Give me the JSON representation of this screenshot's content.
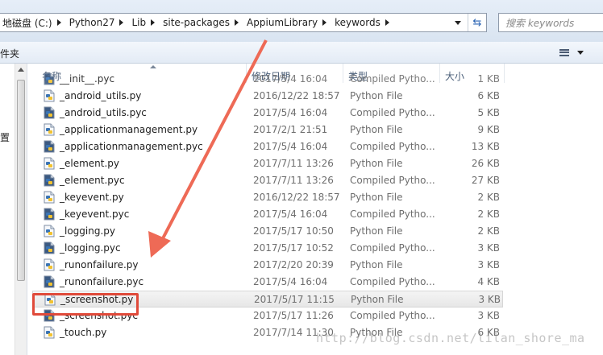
{
  "breadcrumb": [
    "地磁盘 (C:)",
    "Python27",
    "Lib",
    "site-packages",
    "AppiumLibrary",
    "keywords"
  ],
  "search": {
    "placeholder": "搜索 keywords"
  },
  "cmdbar": {
    "label": "件夹"
  },
  "navpane": {
    "item": "置"
  },
  "columns": {
    "name": "名称",
    "date": "修改日期",
    "type": "类型",
    "size": "大小"
  },
  "files": [
    {
      "name": "__init__.pyc",
      "date": "2017/5/4 16:04",
      "type": "Compiled Pytho...",
      "size": "1 KB",
      "icon": "pyc-icon",
      "partial": true
    },
    {
      "name": "_android_utils.py",
      "date": "2016/12/22 18:57",
      "type": "Python File",
      "size": "6 KB",
      "icon": "py-icon"
    },
    {
      "name": "_android_utils.pyc",
      "date": "2017/5/4 16:04",
      "type": "Compiled Pytho...",
      "size": "5 KB",
      "icon": "pyc-icon"
    },
    {
      "name": "_applicationmanagement.py",
      "date": "2017/2/1 21:51",
      "type": "Python File",
      "size": "9 KB",
      "icon": "py-icon"
    },
    {
      "name": "_applicationmanagement.pyc",
      "date": "2017/5/4 16:04",
      "type": "Compiled Pytho...",
      "size": "13 KB",
      "icon": "pyc-icon"
    },
    {
      "name": "_element.py",
      "date": "2017/7/11 13:26",
      "type": "Python File",
      "size": "26 KB",
      "icon": "py-icon"
    },
    {
      "name": "_element.pyc",
      "date": "2017/7/11 13:26",
      "type": "Compiled Pytho...",
      "size": "27 KB",
      "icon": "pyc-icon"
    },
    {
      "name": "_keyevent.py",
      "date": "2016/12/22 18:57",
      "type": "Python File",
      "size": "2 KB",
      "icon": "py-icon"
    },
    {
      "name": "_keyevent.pyc",
      "date": "2017/5/4 16:04",
      "type": "Compiled Pytho...",
      "size": "2 KB",
      "icon": "pyc-icon"
    },
    {
      "name": "_logging.py",
      "date": "2017/5/17 10:50",
      "type": "Python File",
      "size": "2 KB",
      "icon": "py-icon"
    },
    {
      "name": "_logging.pyc",
      "date": "2017/5/17 10:52",
      "type": "Compiled Pytho...",
      "size": "3 KB",
      "icon": "pyc-icon"
    },
    {
      "name": "_runonfailure.py",
      "date": "2017/2/20 20:39",
      "type": "Python File",
      "size": "3 KB",
      "icon": "py-icon"
    },
    {
      "name": "_runonfailure.pyc",
      "date": "2017/5/4 16:04",
      "type": "Compiled Pytho...",
      "size": "4 KB",
      "icon": "pyc-icon"
    },
    {
      "name": "_screenshot.py",
      "date": "2017/5/17 11:15",
      "type": "Python File",
      "size": "3 KB",
      "icon": "py-icon",
      "selected": true
    },
    {
      "name": "_screenshot.pyc",
      "date": "2017/5/17 11:26",
      "type": "Compiled Pytho...",
      "size": "3 KB",
      "icon": "pyc-icon"
    },
    {
      "name": "_touch.py",
      "date": "2017/7/14 11:30",
      "type": "Python File",
      "size": "6 KB",
      "icon": "py-icon"
    }
  ],
  "watermark": "http://blog.csdn.net/lilan_shore_ma",
  "colors": {
    "highlight": "#e04a3a",
    "arrow": "#ee6a56"
  }
}
